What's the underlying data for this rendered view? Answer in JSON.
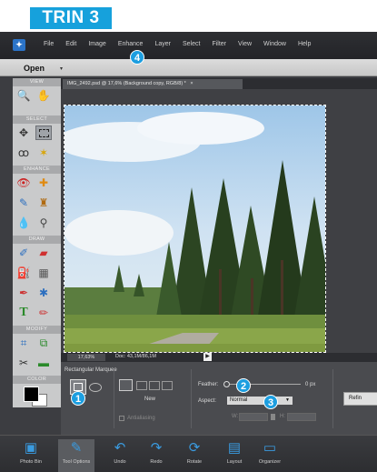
{
  "step_label": "TRIN 3",
  "menubar": {
    "items": [
      "File",
      "Edit",
      "Image",
      "Enhance",
      "Layer",
      "Select",
      "Filter",
      "View",
      "Window",
      "Help"
    ]
  },
  "openbar": {
    "label": "Open",
    "arrow": "▾"
  },
  "toolbox": {
    "sections": [
      "VIEW",
      "SELECT",
      "ENHANCE",
      "DRAW",
      "MODIFY",
      "COLOR"
    ]
  },
  "document": {
    "tab_title": "IMG_2492.psd @ 17,6% (Background copy, RGB/8) *",
    "tab_close": "×",
    "zoom": "17,63%",
    "doc_info": "Doc: 43,1M/86,1M"
  },
  "tool_options": {
    "tool_name": "Rectangular Marquee",
    "new_label": "New",
    "antialiasing_label": "Antialiasing",
    "feather_label": "Feather:",
    "feather_value": "0 px",
    "aspect_label": "Aspect:",
    "aspect_value": "Normal",
    "w_label": "W:",
    "h_label": "H:",
    "refine_label": "Refin"
  },
  "callouts": {
    "one": "1",
    "two": "2",
    "three": "3",
    "four": "4"
  },
  "taskbar": {
    "buttons": [
      {
        "label": "Photo Bin",
        "icon": "photo-bin-icon"
      },
      {
        "label": "Tool Options",
        "icon": "tool-options-icon"
      },
      {
        "label": "Undo",
        "icon": "undo-icon"
      },
      {
        "label": "Redo",
        "icon": "redo-icon"
      },
      {
        "label": "Rotate",
        "icon": "rotate-icon"
      },
      {
        "label": "Layout",
        "icon": "layout-icon"
      },
      {
        "label": "Organizer",
        "icon": "organizer-icon"
      }
    ]
  },
  "colors": {
    "accent": "#16a1dc",
    "callout": "#1c9ee0"
  }
}
